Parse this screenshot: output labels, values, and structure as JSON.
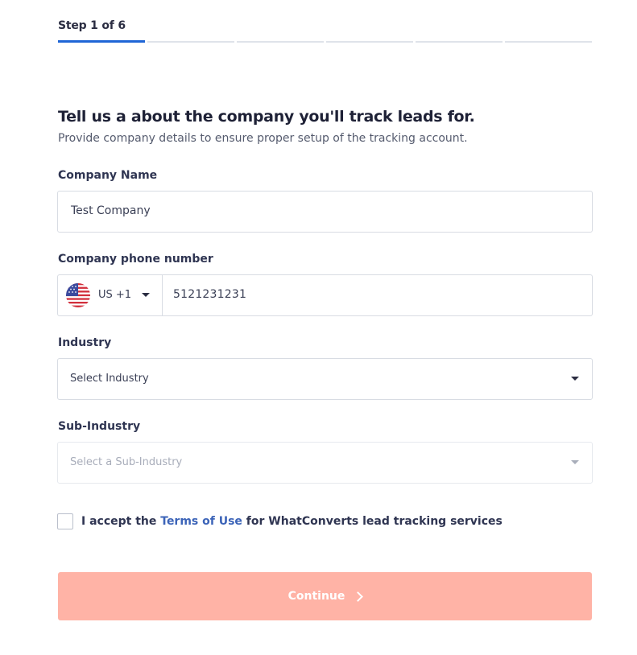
{
  "progress": {
    "step_label": "Step 1 of 6",
    "current_step": 1,
    "total_steps": 6
  },
  "header": {
    "title": "Tell us a about the company you'll track leads for.",
    "subtitle": "Provide company details to ensure proper setup of the tracking account."
  },
  "form": {
    "company_name": {
      "label": "Company Name",
      "value": "Test Company"
    },
    "phone": {
      "label": "Company phone number",
      "country_flag": "us-flag-icon",
      "country_code": "US +1",
      "value": "5121231231"
    },
    "industry": {
      "label": "Industry",
      "selected": "Select Industry"
    },
    "sub_industry": {
      "label": "Sub-Industry",
      "selected": "Select a Sub-Industry",
      "disabled": true
    },
    "terms": {
      "prefix": "I accept the ",
      "link_text": "Terms of Use",
      "suffix": " for WhatConverts lead tracking services",
      "checked": false
    },
    "continue_label": "Continue"
  },
  "colors": {
    "progress_active": "#1f65d6",
    "progress_inactive": "#dfe3ea",
    "link": "#3c64b8",
    "continue_bg_disabled": "#ffb3a6"
  }
}
